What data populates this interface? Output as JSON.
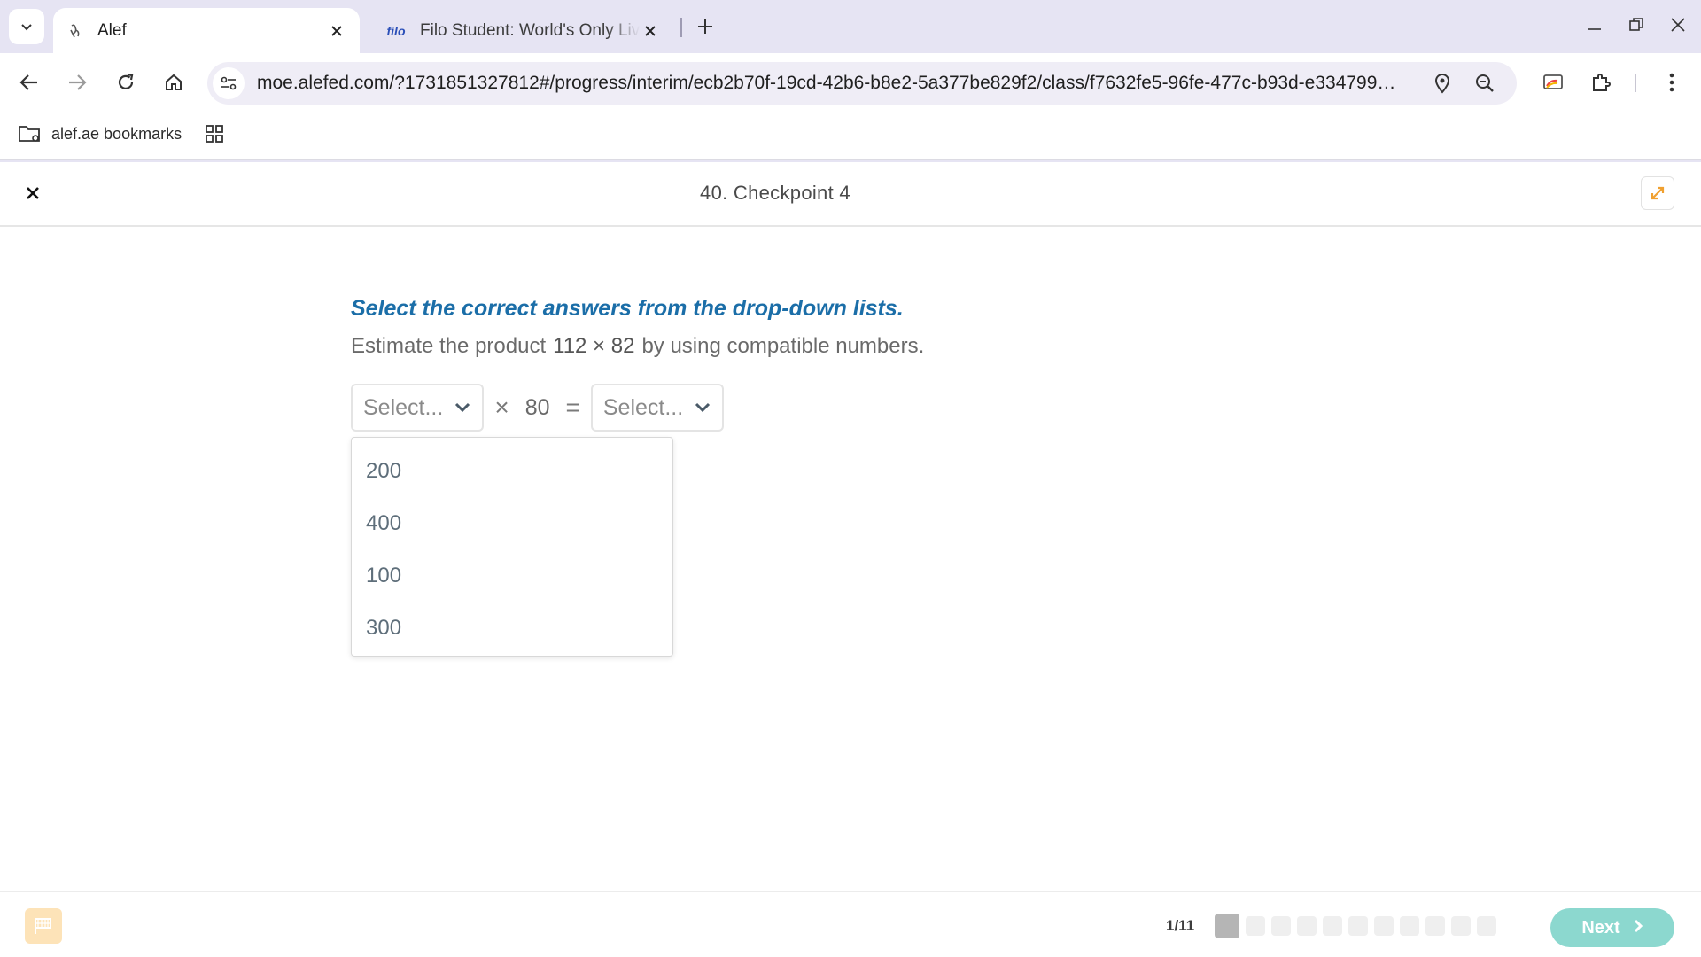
{
  "browser": {
    "tabs": [
      {
        "title": "Alef",
        "active": true
      },
      {
        "title": "Filo Student: World's Only Live Instant Tutoring Platform",
        "favicon_text": "filo",
        "active": false
      }
    ],
    "url": "moe.alefed.com/?1731851327812#/progress/interim/ecb2b70f-19cd-42b6-b8e2-5a377be829f2/class/f7632fe5-96fe-477c-b93d-e334799…",
    "bookmarks": [
      {
        "label": "alef.ae bookmarks"
      }
    ]
  },
  "header": {
    "title": "40. Checkpoint 4"
  },
  "question": {
    "instruction": "Select the correct answers from the drop-down lists.",
    "prompt_prefix": "Estimate the product",
    "expression": "112 × 82",
    "prompt_suffix": "by using compatible numbers.",
    "select1_placeholder": "Select...",
    "operator": "×",
    "operand": "80",
    "equals": "=",
    "select2_placeholder": "Select..."
  },
  "dropdown": {
    "options": [
      "200",
      "400",
      "100",
      "300"
    ]
  },
  "footer": {
    "progress": "1/11",
    "total_steps": 11,
    "current_step": 1,
    "next_label": "Next"
  },
  "colors": {
    "instruction": "#1b6ea8",
    "next_button": "#8cd8cf",
    "flag_button": "#fde3b8",
    "browser_frame": "#e6e4f3"
  }
}
